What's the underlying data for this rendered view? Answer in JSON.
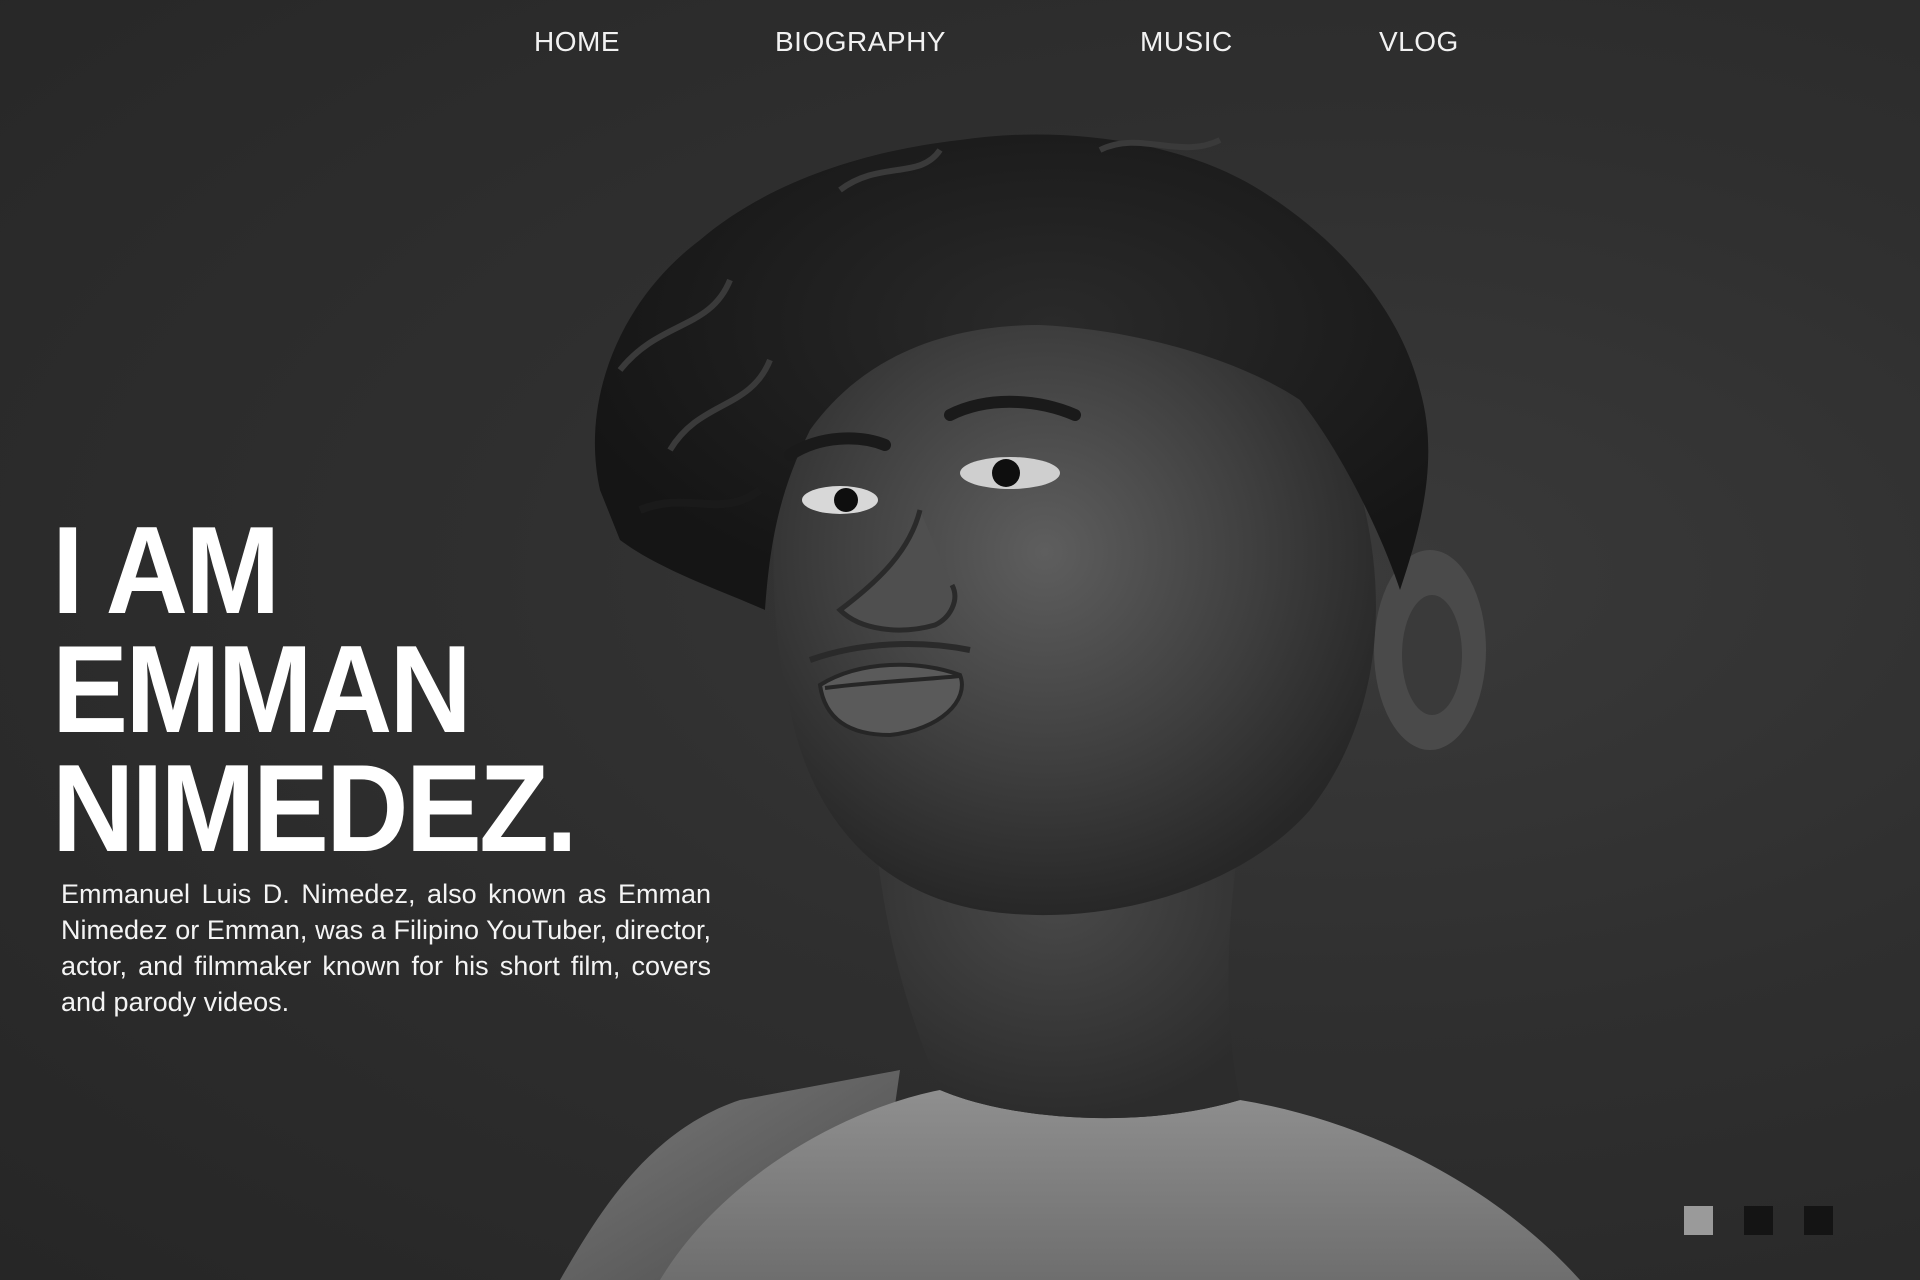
{
  "nav": {
    "items": [
      {
        "label": "HOME"
      },
      {
        "label": "BIOGRAPHY"
      },
      {
        "label": "MUSIC"
      },
      {
        "label": "VLOG"
      }
    ]
  },
  "hero": {
    "title_lines": [
      "I AM",
      "EMMAN",
      "NIMEDEZ."
    ],
    "description": "Emmanuel Luis D. Nimedez, also known as Emman Nimedez or Emman, was a Filipino YouTuber, director, actor, and filmmaker known for his short film, covers and parody videos."
  },
  "slider": {
    "count": 3,
    "active_index": 0
  },
  "colors": {
    "background": "#2f2f2f",
    "text": "#ffffff",
    "dot_active": "#9a9a9a",
    "dot_inactive": "#141414"
  },
  "image": {
    "subject": "portrait-photo",
    "style": "grayscale"
  }
}
